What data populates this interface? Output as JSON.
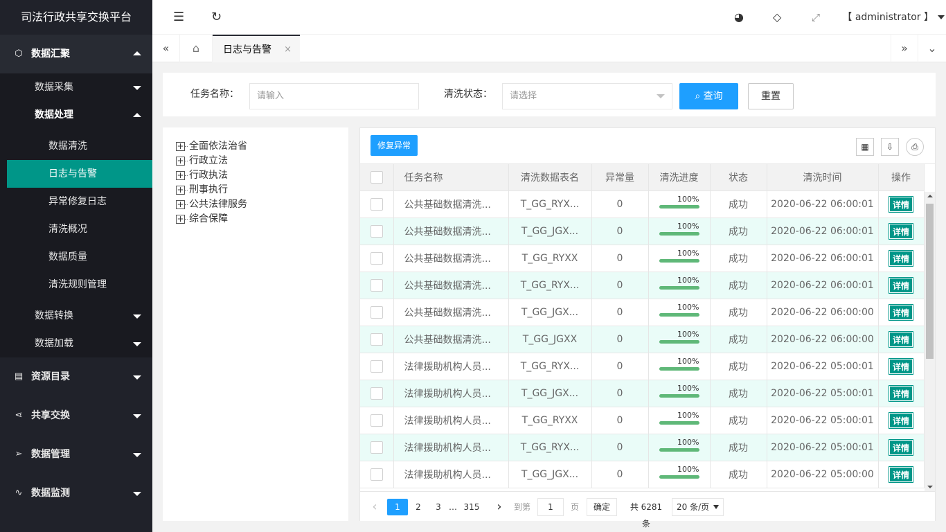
{
  "app": {
    "title": "司法行政共享交换平台"
  },
  "sidebar": {
    "groups": [
      {
        "label": "数据汇聚",
        "icon": "cube-icon"
      },
      {
        "label": "资源目录",
        "icon": "catalog-icon"
      },
      {
        "label": "共享交换",
        "icon": "share-icon"
      },
      {
        "label": "数据管理",
        "icon": "send-icon"
      },
      {
        "label": "数据监测",
        "icon": "pulse-icon"
      }
    ],
    "sub": {
      "collect": "数据采集",
      "process": "数据处理",
      "transform": "数据转换",
      "load": "数据加载"
    },
    "leaves": [
      "数据清洗",
      "日志与告警",
      "异常修复日志",
      "清洗概况",
      "数据质量",
      "清洗规则管理"
    ]
  },
  "header": {
    "user": "【 administrator 】"
  },
  "tabs": {
    "active": "日志与告警",
    "close": "×"
  },
  "search": {
    "task_label": "任务名称：",
    "task_placeholder": "请输入",
    "status_label": "清洗状态：",
    "status_placeholder": "请选择",
    "query_label": "查询",
    "reset_label": "重置"
  },
  "tree": {
    "nodes": [
      "全面依法治省",
      "行政立法",
      "行政执法",
      "刑事执行",
      "公共法律服务",
      "综合保障"
    ]
  },
  "table": {
    "fix_label": "修复异常",
    "columns": [
      "任务名称",
      "清洗数据表名",
      "异常量",
      "清洗进度",
      "状态",
      "清洗时间",
      "操作"
    ],
    "detail_label": "详情",
    "rows": [
      {
        "name": "公共基础数据清洗...",
        "table": "T_GG_RYX...",
        "errors": "0",
        "progress": 100,
        "progress_label": "100%",
        "status": "成功",
        "time": "2020-06-22 06:00:01"
      },
      {
        "name": "公共基础数据清洗...",
        "table": "T_GG_JGX...",
        "errors": "0",
        "progress": 100,
        "progress_label": "100%",
        "status": "成功",
        "time": "2020-06-22 06:00:01"
      },
      {
        "name": "公共基础数据清洗...",
        "table": "T_GG_RYXX",
        "errors": "0",
        "progress": 100,
        "progress_label": "100%",
        "status": "成功",
        "time": "2020-06-22 06:00:01"
      },
      {
        "name": "公共基础数据清洗...",
        "table": "T_GG_RYX...",
        "errors": "0",
        "progress": 100,
        "progress_label": "100%",
        "status": "成功",
        "time": "2020-06-22 06:00:01"
      },
      {
        "name": "公共基础数据清洗...",
        "table": "T_GG_JGX...",
        "errors": "0",
        "progress": 100,
        "progress_label": "100%",
        "status": "成功",
        "time": "2020-06-22 06:00:00"
      },
      {
        "name": "公共基础数据清洗...",
        "table": "T_GG_JGXX",
        "errors": "0",
        "progress": 100,
        "progress_label": "100%",
        "status": "成功",
        "time": "2020-06-22 06:00:00"
      },
      {
        "name": "法律援助机构人员...",
        "table": "T_GG_RYX...",
        "errors": "0",
        "progress": 100,
        "progress_label": "100%",
        "status": "成功",
        "time": "2020-06-22 05:00:01"
      },
      {
        "name": "法律援助机构人员...",
        "table": "T_GG_JGX...",
        "errors": "0",
        "progress": 100,
        "progress_label": "100%",
        "status": "成功",
        "time": "2020-06-22 05:00:01"
      },
      {
        "name": "法律援助机构人员...",
        "table": "T_GG_RYXX",
        "errors": "0",
        "progress": 100,
        "progress_label": "100%",
        "status": "成功",
        "time": "2020-06-22 05:00:01"
      },
      {
        "name": "法律援助机构人员...",
        "table": "T_GG_RYX...",
        "errors": "0",
        "progress": 100,
        "progress_label": "100%",
        "status": "成功",
        "time": "2020-06-22 05:00:01"
      },
      {
        "name": "法律援助机构人员...",
        "table": "T_GG_JGX...",
        "errors": "0",
        "progress": 100,
        "progress_label": "100%",
        "status": "成功",
        "time": "2020-06-22 05:00:00"
      }
    ]
  },
  "pager": {
    "prev": "‹",
    "pages": [
      "1",
      "2",
      "3"
    ],
    "ellipsis": "…",
    "last": "315",
    "next": "›",
    "goto_label": "到第",
    "goto_value": "1",
    "page_unit": "页",
    "confirm": "确定",
    "total": "共 6281 条",
    "page_size": "20 条/页"
  },
  "colors": {
    "sidebar_bg": "#20222a",
    "active_leaf": "#009688",
    "primary": "#1e9fff",
    "row_alt": "#eafcf8",
    "progress": "#5fb878"
  }
}
